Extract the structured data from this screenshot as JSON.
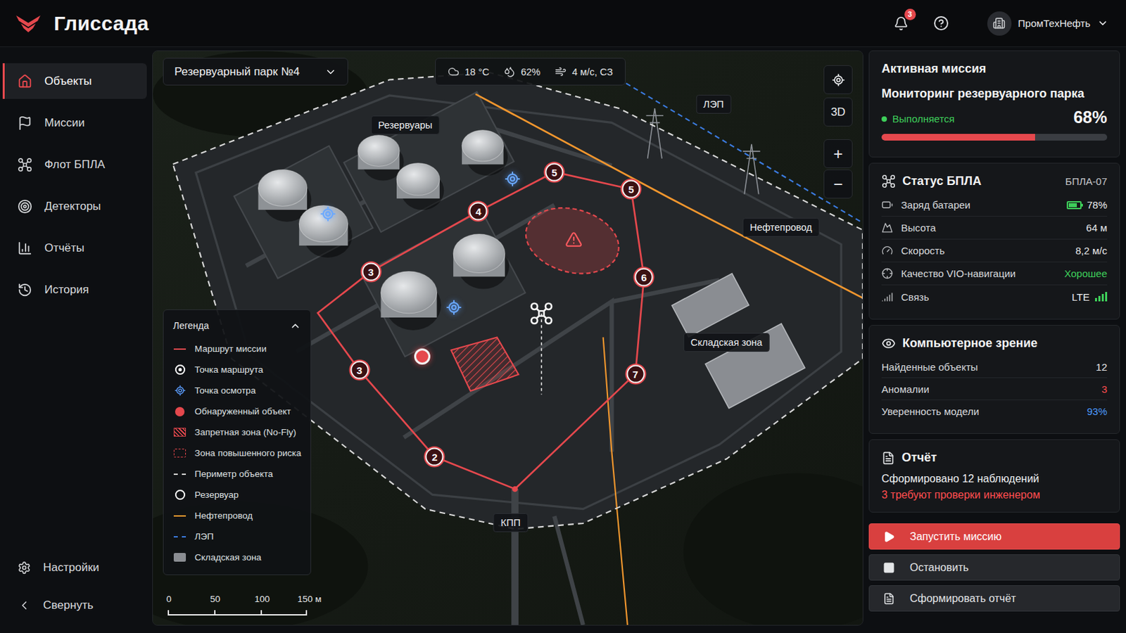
{
  "app": {
    "name": "Глиссада"
  },
  "header": {
    "notifications": "3",
    "org": "ПромТехНефть"
  },
  "sidebar": {
    "items": [
      {
        "label": "Объекты",
        "selected": true
      },
      {
        "label": "Миссии",
        "selected": false
      },
      {
        "label": "Флот БПЛА",
        "selected": false
      },
      {
        "label": "Детекторы",
        "selected": false
      },
      {
        "label": "Отчёты",
        "selected": false
      },
      {
        "label": "История",
        "selected": false
      }
    ],
    "footer": [
      {
        "label": "Настройки"
      },
      {
        "label": "Свернуть"
      }
    ]
  },
  "map": {
    "site": "Резервуарный парк №4",
    "weather": [
      {
        "kind": "temperature",
        "value": "18 °C"
      },
      {
        "kind": "humidity",
        "value": "62%"
      },
      {
        "kind": "wind",
        "value": "4 м/с, СЗ"
      }
    ],
    "view_toggle": "3D",
    "zoom": [
      "+",
      "−"
    ],
    "labels": [
      {
        "text": "Резервуары"
      },
      {
        "text": "ЛЭП"
      },
      {
        "text": "Нефтепровод"
      },
      {
        "text": "Складская зона"
      },
      {
        "text": "КПП"
      }
    ],
    "route_points": [
      {
        "label": "2"
      },
      {
        "label": "3"
      },
      {
        "label": "3"
      },
      {
        "label": "4"
      },
      {
        "label": "5"
      },
      {
        "label": "5"
      },
      {
        "label": "6"
      },
      {
        "label": "7"
      }
    ],
    "legend": {
      "title": "Легенда",
      "expanded": true,
      "items": [
        {
          "label": "Маршрут миссии",
          "kind": "route-line",
          "color": "#e5484d"
        },
        {
          "label": "Точка маршрута",
          "kind": "waypoint",
          "color": "#ffffff"
        },
        {
          "label": "Точка осмотра",
          "kind": "inspection",
          "color": "#5b9dff"
        },
        {
          "label": "Обнаруженный объект",
          "kind": "detected",
          "color": "#e5484d"
        },
        {
          "label": "Запретная зона (No-Fly)",
          "kind": "no-fly",
          "color": "#e5484d"
        },
        {
          "label": "Зона повышенного риска",
          "kind": "risk-zone",
          "color": "#e5484d"
        },
        {
          "label": "Периметр объекта",
          "kind": "perimeter",
          "color": "#d8d8d8"
        },
        {
          "label": "Резервуар",
          "kind": "tank",
          "color": "#ffffff"
        },
        {
          "label": "Нефтепровод",
          "kind": "pipeline",
          "color": "#f0962e"
        },
        {
          "label": "ЛЭП",
          "kind": "power-line",
          "color": "#3b7be0"
        },
        {
          "label": "Складская зона",
          "kind": "warehouse",
          "color": "#8a8d92"
        }
      ]
    },
    "scale": {
      "ticks": [
        "0",
        "50",
        "100",
        "150 м"
      ]
    }
  },
  "mission": {
    "title": "Активная миссия",
    "name": "Мониторинг резервуарного парка",
    "status": "Выполняется",
    "status_color": "#3ecf5a",
    "progress": "68%",
    "level": 0.68
  },
  "uav": {
    "title": "Статус БПЛА",
    "id": "БПЛА-07",
    "rows": [
      {
        "label": "Заряд батареи",
        "value": "78%",
        "kind": "battery",
        "level": 0.78,
        "color": "#3ecf5a"
      },
      {
        "label": "Высота",
        "value": "64 м",
        "kind": "text",
        "color": "#e8e9eb"
      },
      {
        "label": "Скорость",
        "value": "8,2 м/с",
        "kind": "text",
        "color": "#e8e9eb"
      },
      {
        "label": "Качество VIO-навигации",
        "value": "Хорошее",
        "kind": "text",
        "color": "#3ecf5a"
      },
      {
        "label": "Связь",
        "value": "LTE",
        "kind": "signal",
        "level": 1,
        "color": "#3ecf5a"
      }
    ]
  },
  "vision": {
    "title": "Компьютерное зрение",
    "rows": [
      {
        "label": "Найденные объекты",
        "value": "12",
        "color": "#e8e9eb"
      },
      {
        "label": "Аномалии",
        "value": "3",
        "color": "#ff4d4f"
      },
      {
        "label": "Уверенность модели",
        "value": "93%",
        "color": "#4c9bff"
      }
    ]
  },
  "report": {
    "title": "Отчёт",
    "summary": "Сформировано 12 наблюдений",
    "alert": "3 требуют проверки инженером"
  },
  "actions": [
    {
      "label": "Запустить миссию",
      "kind": "primary"
    },
    {
      "label": "Остановить",
      "kind": "secondary"
    },
    {
      "label": "Сформировать отчёт",
      "kind": "secondary"
    }
  ]
}
